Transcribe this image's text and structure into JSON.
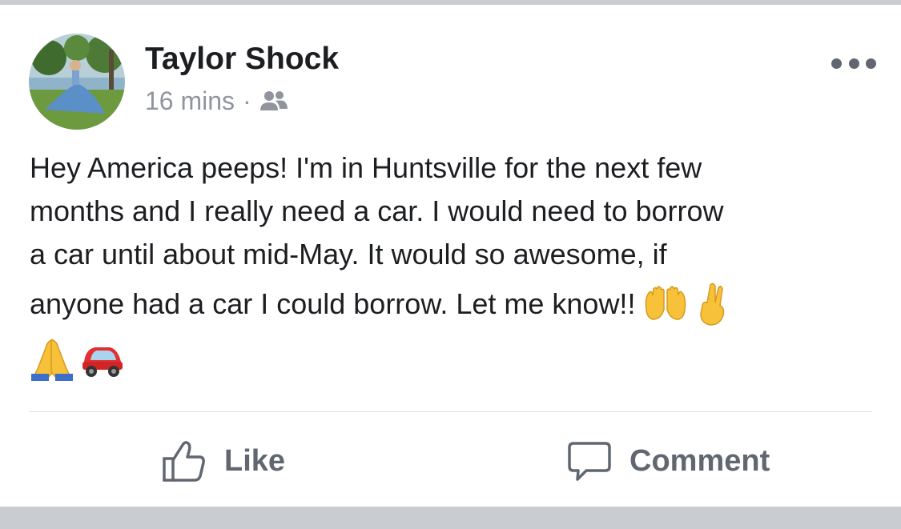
{
  "post": {
    "author": "Taylor Shock",
    "time": "16 mins",
    "separator": "·",
    "audience_icon": "friends-icon",
    "text_lines": [
      "Hey America peeps! I'm in Huntsville for the next few",
      "months and I really need a car. I would need to borrow",
      "a car until about mid-May. It would so awesome, if",
      "anyone had a car I could borrow. Let me know!!"
    ],
    "emojis": [
      "raised-hands-emoji",
      "crossed-fingers-emoji",
      "folded-hands-emoji",
      "red-car-emoji"
    ]
  },
  "actions": {
    "like_label": "Like",
    "comment_label": "Comment"
  },
  "colors": {
    "text": "#1c1e21",
    "secondary": "#90949c",
    "action": "#606770",
    "band": "#c9ccd1"
  }
}
